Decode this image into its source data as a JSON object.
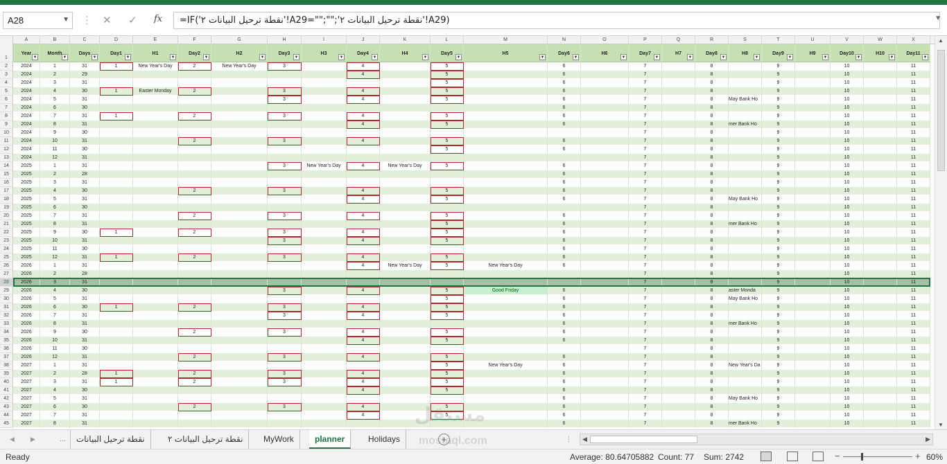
{
  "name_box": "A28",
  "formula": "=IF('نقطة ترحيل البيانات ٢'!A29=\"\";\"\";'نقطة ترحيل البيانات ٢'!A29)",
  "fx_label": "fx",
  "columns": [
    "A",
    "B",
    "C",
    "D",
    "E",
    "F",
    "G",
    "H",
    "I",
    "J",
    "K",
    "L",
    "M",
    "N",
    "O",
    "P",
    "Q",
    "R",
    "S",
    "T",
    "U",
    "V",
    "W",
    "X"
  ],
  "headers": [
    "Year",
    "Month",
    "Days",
    "Day1",
    "H1",
    "Day2",
    "H2",
    "Day3",
    "H3",
    "Day4",
    "H4",
    "Day5",
    "H5",
    "Day6",
    "H6",
    "Day7",
    "H7",
    "Day8",
    "H8",
    "Day9",
    "H9",
    "Day10",
    "H10",
    "Day11"
  ],
  "rows": [
    {
      "n": "2",
      "v": [
        "2024",
        "1",
        "31",
        "1",
        "New Year's Day",
        "2",
        "New Year's Day",
        "3",
        "",
        "4",
        "",
        "5",
        "",
        "6",
        "",
        "7",
        "",
        "8",
        "",
        "9",
        "",
        "10",
        "",
        "11"
      ]
    },
    {
      "n": "3",
      "v": [
        "2024",
        "2",
        "29",
        "",
        "",
        "",
        "",
        "",
        "",
        "4",
        "",
        "5",
        "",
        "6",
        "",
        "7",
        "",
        "8",
        "",
        "9",
        "",
        "10",
        "",
        "11"
      ]
    },
    {
      "n": "4",
      "v": [
        "2024",
        "3",
        "31",
        "",
        "",
        "",
        "",
        "",
        "",
        "",
        "",
        "5",
        "",
        "6",
        "",
        "7",
        "",
        "8",
        "",
        "9",
        "",
        "10",
        "",
        "11"
      ]
    },
    {
      "n": "5",
      "v": [
        "2024",
        "4",
        "30",
        "1",
        "Easter Monday",
        "2",
        "",
        "3",
        "",
        "4",
        "",
        "5",
        "",
        "6",
        "",
        "7",
        "",
        "8",
        "",
        "9",
        "",
        "10",
        "",
        "11"
      ]
    },
    {
      "n": "6",
      "v": [
        "2024",
        "5",
        "31",
        "",
        "",
        "",
        "",
        "3",
        "",
        "4",
        "",
        "5",
        "",
        "6",
        "",
        "7",
        "",
        "8",
        "May Bank Ho",
        "9",
        "",
        "10",
        "",
        "11"
      ]
    },
    {
      "n": "7",
      "v": [
        "2024",
        "6",
        "30",
        "",
        "",
        "",
        "",
        "",
        "",
        "",
        "",
        "",
        "",
        "6",
        "",
        "7",
        "",
        "8",
        "",
        "9",
        "",
        "10",
        "",
        "11"
      ]
    },
    {
      "n": "8",
      "v": [
        "2024",
        "7",
        "31",
        "1",
        "",
        "2",
        "",
        "3",
        "",
        "4",
        "",
        "5",
        "",
        "6",
        "",
        "7",
        "",
        "8",
        "",
        "9",
        "",
        "10",
        "",
        "11"
      ]
    },
    {
      "n": "9",
      "v": [
        "2024",
        "8",
        "31",
        "",
        "",
        "",
        "",
        "",
        "",
        "4",
        "",
        "5",
        "",
        "6",
        "",
        "7",
        "",
        "8",
        "mer Bank Ho",
        "9",
        "",
        "10",
        "",
        "11"
      ]
    },
    {
      "n": "10",
      "v": [
        "2024",
        "9",
        "30",
        "",
        "",
        "",
        "",
        "",
        "",
        "",
        "",
        "",
        "",
        "",
        "",
        "7",
        "",
        "8",
        "",
        "9",
        "",
        "10",
        "",
        "11"
      ]
    },
    {
      "n": "11",
      "v": [
        "2024",
        "10",
        "31",
        "",
        "",
        "2",
        "",
        "3",
        "",
        "4",
        "",
        "5",
        "",
        "6",
        "",
        "7",
        "",
        "8",
        "",
        "9",
        "",
        "10",
        "",
        "11"
      ]
    },
    {
      "n": "12",
      "v": [
        "2024",
        "11",
        "30",
        "",
        "",
        "",
        "",
        "",
        "",
        "",
        "",
        "5",
        "",
        "6",
        "",
        "7",
        "",
        "8",
        "",
        "9",
        "",
        "10",
        "",
        "11"
      ]
    },
    {
      "n": "13",
      "v": [
        "2024",
        "12",
        "31",
        "",
        "",
        "",
        "",
        "",
        "",
        "",
        "",
        "",
        "",
        "",
        "",
        "7",
        "",
        "8",
        "",
        "9",
        "",
        "10",
        "",
        "11"
      ]
    },
    {
      "n": "14",
      "v": [
        "2025",
        "1",
        "31",
        "",
        "",
        "",
        "",
        "3",
        "New Year's Day",
        "4",
        "New Year's Day",
        "5",
        "",
        "6",
        "",
        "7",
        "",
        "8",
        "",
        "9",
        "",
        "10",
        "",
        "11"
      ]
    },
    {
      "n": "15",
      "v": [
        "2025",
        "2",
        "28",
        "",
        "",
        "",
        "",
        "",
        "",
        "",
        "",
        "",
        "",
        "6",
        "",
        "7",
        "",
        "8",
        "",
        "9",
        "",
        "10",
        "",
        "11"
      ]
    },
    {
      "n": "16",
      "v": [
        "2025",
        "3",
        "31",
        "",
        "",
        "",
        "",
        "",
        "",
        "",
        "",
        "",
        "",
        "6",
        "",
        "7",
        "",
        "8",
        "",
        "9",
        "",
        "10",
        "",
        "11"
      ]
    },
    {
      "n": "17",
      "v": [
        "2025",
        "4",
        "30",
        "",
        "",
        "2",
        "",
        "3",
        "",
        "4",
        "",
        "5",
        "",
        "6",
        "",
        "7",
        "",
        "8",
        "",
        "9",
        "",
        "10",
        "",
        "11"
      ]
    },
    {
      "n": "18",
      "v": [
        "2025",
        "5",
        "31",
        "",
        "",
        "",
        "",
        "",
        "",
        "4",
        "",
        "5",
        "",
        "6",
        "",
        "7",
        "",
        "8",
        "May Bank Ho",
        "9",
        "",
        "10",
        "",
        "11"
      ]
    },
    {
      "n": "19",
      "v": [
        "2025",
        "6",
        "30",
        "",
        "",
        "",
        "",
        "",
        "",
        "",
        "",
        "",
        "",
        "",
        "",
        "7",
        "",
        "8",
        "",
        "9",
        "",
        "10",
        "",
        "11"
      ]
    },
    {
      "n": "20",
      "v": [
        "2025",
        "7",
        "31",
        "",
        "",
        "2",
        "",
        "3",
        "",
        "4",
        "",
        "5",
        "",
        "6",
        "",
        "7",
        "",
        "8",
        "",
        "9",
        "",
        "10",
        "",
        "11"
      ]
    },
    {
      "n": "21",
      "v": [
        "2025",
        "8",
        "31",
        "",
        "",
        "",
        "",
        "",
        "",
        "",
        "",
        "5",
        "",
        "6",
        "",
        "7",
        "",
        "8",
        "mer Bank Ho",
        "9",
        "",
        "10",
        "",
        "11"
      ]
    },
    {
      "n": "22",
      "v": [
        "2025",
        "9",
        "30",
        "1",
        "",
        "2",
        "",
        "3",
        "",
        "4",
        "",
        "5",
        "",
        "6",
        "",
        "7",
        "",
        "8",
        "",
        "9",
        "",
        "10",
        "",
        "11"
      ]
    },
    {
      "n": "23",
      "v": [
        "2025",
        "10",
        "31",
        "",
        "",
        "",
        "",
        "3",
        "",
        "4",
        "",
        "5",
        "",
        "6",
        "",
        "7",
        "",
        "8",
        "",
        "9",
        "",
        "10",
        "",
        "11"
      ]
    },
    {
      "n": "24",
      "v": [
        "2025",
        "11",
        "30",
        "",
        "",
        "",
        "",
        "",
        "",
        "",
        "",
        "",
        "",
        "6",
        "",
        "7",
        "",
        "8",
        "",
        "9",
        "",
        "10",
        "",
        "11"
      ]
    },
    {
      "n": "25",
      "v": [
        "2025",
        "12",
        "31",
        "1",
        "",
        "2",
        "",
        "3",
        "",
        "4",
        "",
        "5",
        "",
        "6",
        "",
        "7",
        "",
        "8",
        "",
        "9",
        "",
        "10",
        "",
        "11"
      ]
    },
    {
      "n": "26",
      "v": [
        "2026",
        "1",
        "31",
        "",
        "",
        "",
        "",
        "",
        "",
        "4",
        "New Year's Day",
        "5",
        "New Year's Day",
        "6",
        "",
        "7",
        "",
        "8",
        "",
        "9",
        "",
        "10",
        "",
        "11"
      ]
    },
    {
      "n": "27",
      "v": [
        "2026",
        "2",
        "28",
        "",
        "",
        "",
        "",
        "",
        "",
        "",
        "",
        "",
        "",
        "",
        "",
        "7",
        "",
        "8",
        "",
        "9",
        "",
        "10",
        "",
        "11"
      ]
    },
    {
      "n": "28",
      "v": [
        "2026",
        "3",
        "31",
        "",
        "",
        "",
        "",
        "",
        "",
        "",
        "",
        "",
        "",
        "",
        "",
        "7",
        "",
        "8",
        "",
        "9",
        "",
        "10",
        "",
        "11"
      ]
    },
    {
      "n": "29",
      "v": [
        "2026",
        "4",
        "30",
        "",
        "",
        "",
        "",
        "3",
        "",
        "4",
        "",
        "5",
        "Good Friday",
        "6",
        "",
        "7",
        "",
        "8",
        "aster Monda",
        "9",
        "",
        "10",
        "",
        "11"
      ]
    },
    {
      "n": "30",
      "v": [
        "2026",
        "5",
        "31",
        "",
        "",
        "",
        "",
        "",
        "",
        "",
        "",
        "5",
        "",
        "6",
        "",
        "7",
        "",
        "8",
        "May Bank Ho",
        "9",
        "",
        "10",
        "",
        "11"
      ]
    },
    {
      "n": "31",
      "v": [
        "2026",
        "6",
        "30",
        "1",
        "",
        "2",
        "",
        "3",
        "",
        "4",
        "",
        "5",
        "",
        "6",
        "",
        "7",
        "",
        "8",
        "",
        "9",
        "",
        "10",
        "",
        "11"
      ]
    },
    {
      "n": "32",
      "v": [
        "2026",
        "7",
        "31",
        "",
        "",
        "",
        "",
        "3",
        "",
        "4",
        "",
        "5",
        "",
        "6",
        "",
        "7",
        "",
        "8",
        "",
        "9",
        "",
        "10",
        "",
        "11"
      ]
    },
    {
      "n": "33",
      "v": [
        "2026",
        "8",
        "31",
        "",
        "",
        "",
        "",
        "",
        "",
        "",
        "",
        "",
        "",
        "6",
        "",
        "7",
        "",
        "8",
        "mer Bank Ho",
        "9",
        "",
        "10",
        "",
        "11"
      ]
    },
    {
      "n": "34",
      "v": [
        "2026",
        "9",
        "30",
        "",
        "",
        "2",
        "",
        "3",
        "",
        "4",
        "",
        "5",
        "",
        "6",
        "",
        "7",
        "",
        "8",
        "",
        "9",
        "",
        "10",
        "",
        "11"
      ]
    },
    {
      "n": "35",
      "v": [
        "2026",
        "10",
        "31",
        "",
        "",
        "",
        "",
        "",
        "",
        "4",
        "",
        "5",
        "",
        "6",
        "",
        "7",
        "",
        "8",
        "",
        "9",
        "",
        "10",
        "",
        "11"
      ]
    },
    {
      "n": "36",
      "v": [
        "2026",
        "11",
        "30",
        "",
        "",
        "",
        "",
        "",
        "",
        "",
        "",
        "",
        "",
        "",
        "",
        "7",
        "",
        "8",
        "",
        "9",
        "",
        "10",
        "",
        "11"
      ]
    },
    {
      "n": "37",
      "v": [
        "2026",
        "12",
        "31",
        "",
        "",
        "2",
        "",
        "3",
        "",
        "4",
        "",
        "5",
        "",
        "6",
        "",
        "7",
        "",
        "8",
        "",
        "9",
        "",
        "10",
        "",
        "11"
      ]
    },
    {
      "n": "38",
      "v": [
        "2027",
        "1",
        "31",
        "",
        "",
        "",
        "",
        "",
        "",
        "",
        "",
        "5",
        "New Year's Day",
        "6",
        "",
        "7",
        "",
        "8",
        "New Year's Da",
        "9",
        "",
        "10",
        "",
        "11"
      ]
    },
    {
      "n": "39",
      "v": [
        "2027",
        "2",
        "28",
        "1",
        "",
        "2",
        "",
        "3",
        "",
        "4",
        "",
        "5",
        "",
        "6",
        "",
        "7",
        "",
        "8",
        "",
        "9",
        "",
        "10",
        "",
        "11"
      ]
    },
    {
      "n": "40",
      "v": [
        "2027",
        "3",
        "31",
        "1",
        "",
        "2",
        "",
        "3",
        "",
        "4",
        "",
        "5",
        "",
        "6",
        "",
        "7",
        "",
        "8",
        "",
        "9",
        "",
        "10",
        "",
        "11"
      ]
    },
    {
      "n": "41",
      "v": [
        "2027",
        "4",
        "30",
        "",
        "",
        "",
        "",
        "",
        "",
        "4",
        "",
        "5",
        "",
        "6",
        "",
        "7",
        "",
        "8",
        "",
        "9",
        "",
        "10",
        "",
        "11"
      ]
    },
    {
      "n": "42",
      "v": [
        "2027",
        "5",
        "31",
        "",
        "",
        "",
        "",
        "",
        "",
        "",
        "",
        "",
        "",
        "6",
        "",
        "7",
        "",
        "8",
        "May Bank Ho",
        "9",
        "",
        "10",
        "",
        "11"
      ]
    },
    {
      "n": "43",
      "v": [
        "2027",
        "6",
        "30",
        "",
        "",
        "2",
        "",
        "3",
        "",
        "4",
        "",
        "5",
        "",
        "6",
        "",
        "7",
        "",
        "8",
        "",
        "9",
        "",
        "10",
        "",
        "11"
      ]
    },
    {
      "n": "44",
      "v": [
        "2027",
        "7",
        "31",
        "",
        "",
        "",
        "",
        "",
        "",
        "4",
        "",
        "5",
        "",
        "6",
        "",
        "7",
        "",
        "8",
        "",
        "9",
        "",
        "10",
        "",
        "11"
      ]
    },
    {
      "n": "45",
      "v": [
        "2027",
        "8",
        "31",
        "",
        "",
        "",
        "",
        "",
        "",
        "",
        "",
        "",
        "",
        "6",
        "",
        "7",
        "",
        "8",
        "mer Bank Ho",
        "9",
        "",
        "10",
        "",
        "11"
      ]
    }
  ],
  "selected_row": "28",
  "highlight_cell": {
    "row": "29",
    "col": "M"
  },
  "sheet_tabs": [
    "نقطة ترحيل البيانات",
    "نقطة ترحيل البيانات ٢",
    "MyWork",
    "planner",
    "Holidays"
  ],
  "active_tab": "planner",
  "status": {
    "ready": "Ready",
    "average": "Average: 80.64705882",
    "count": "Count: 77",
    "sum": "Sum: 2742",
    "zoom": "60%"
  },
  "watermark": "مستقل",
  "watermark_url": "mostaql.com",
  "accent_color": "#217346",
  "header_fill": "#c6e0b4"
}
